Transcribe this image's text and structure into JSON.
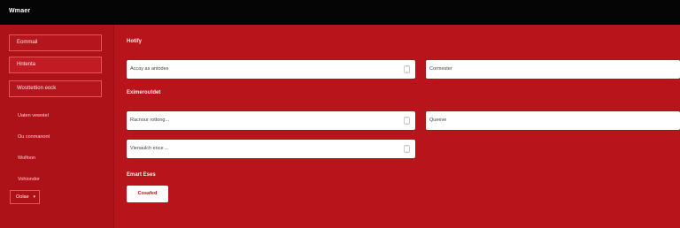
{
  "app": {
    "title": "Wmaer"
  },
  "sidebar": {
    "boxes": [
      {
        "label": "Eommail"
      },
      {
        "label": "Hntenta"
      },
      {
        "label": "Wosttettion eock"
      }
    ],
    "links": [
      {
        "label": "Uaten vewotel"
      },
      {
        "label": "Ou conmanont"
      },
      {
        "label": "Wolfoon"
      },
      {
        "label": "Vohiondor"
      }
    ],
    "dropdown": {
      "value": "Oolae"
    }
  },
  "main": {
    "section1": {
      "label": "Hotify"
    },
    "section2": {
      "label": "Eximeroutdet"
    },
    "section3": {
      "label": "Emart Eses"
    },
    "fields": [
      {
        "value": "Accay as antodes"
      },
      {
        "value": "Cormester"
      },
      {
        "value": "Racnour rottong..."
      },
      {
        "value": "Queeve"
      },
      {
        "value": "Vienaulch ence    ..."
      }
    ],
    "submit": {
      "label": "Cosafed"
    }
  },
  "colors": {
    "background": "#b8141b",
    "topbar": "#050505",
    "field": "#ffffff"
  }
}
